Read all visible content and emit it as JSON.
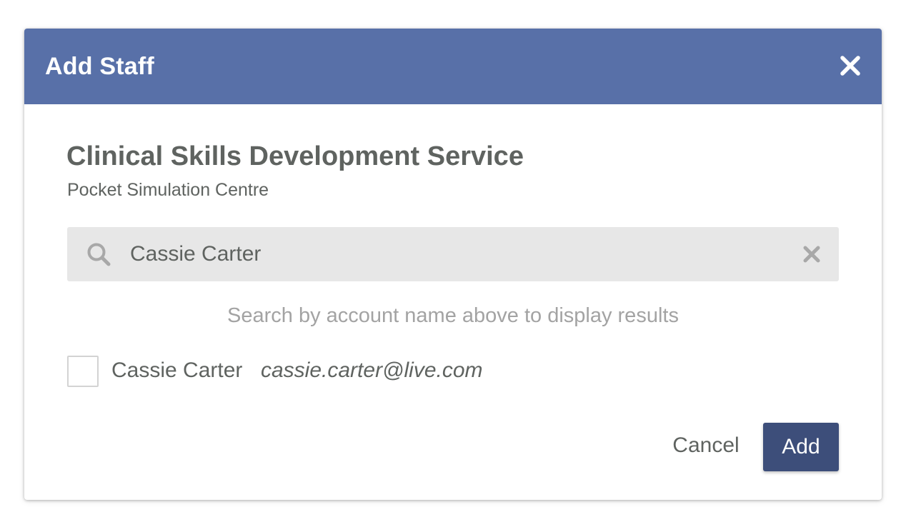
{
  "dialog": {
    "title": "Add Staff",
    "close_icon": "close-icon"
  },
  "organization": {
    "name": "Clinical Skills Development Service",
    "subtitle": "Pocket Simulation Centre"
  },
  "search": {
    "value": "Cassie Carter",
    "search_icon": "search-icon",
    "clear_icon": "clear-icon"
  },
  "hint": "Search by account name above to display results",
  "results": [
    {
      "name": "Cassie Carter",
      "email": "cassie.carter@live.com",
      "checked": false
    }
  ],
  "actions": {
    "cancel_label": "Cancel",
    "add_label": "Add"
  },
  "colors": {
    "header": "#5870a8",
    "primary_button": "#3d4e7a",
    "text": "#5f6360",
    "hint_text": "#a3a3a3",
    "search_bg": "#e7e7e7"
  }
}
